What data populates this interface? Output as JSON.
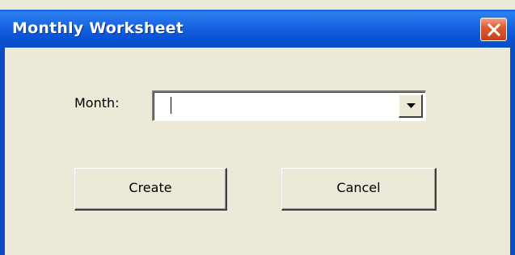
{
  "window": {
    "title": "Monthly Worksheet"
  },
  "form": {
    "month_label": "Month:",
    "month_value": ""
  },
  "buttons": {
    "create_label": "Create",
    "cancel_label": "Cancel"
  },
  "icons": {
    "close": "close-icon",
    "dropdown": "chevron-down-icon"
  },
  "colors": {
    "titlebar": "#0a4cc6",
    "window_bg": "#ece9d8",
    "close_button": "#e05a30"
  }
}
